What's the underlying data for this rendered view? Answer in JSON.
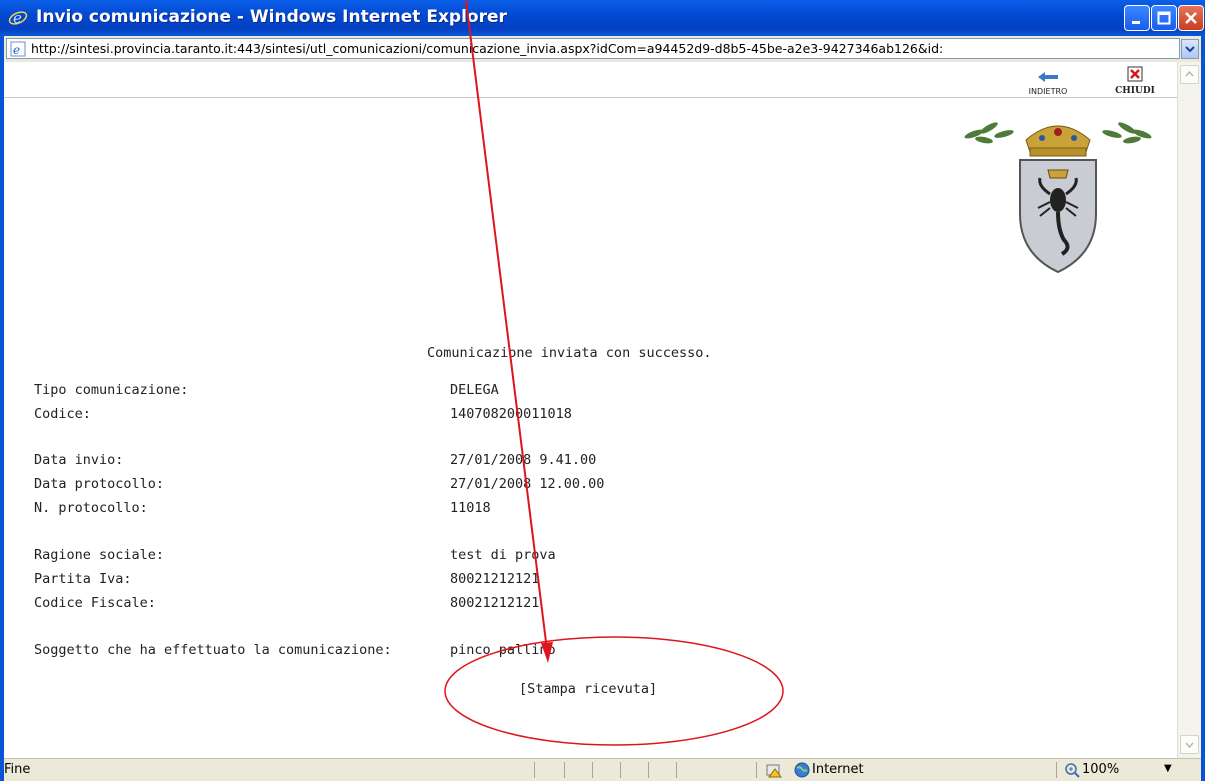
{
  "window": {
    "title": "Invio comunicazione - Windows Internet Explorer"
  },
  "address": {
    "url": "http://sintesi.provincia.taranto.it:443/sintesi/utl_comunicazioni/comunicazione_invia.aspx?idCom=a94452d9-d8b5-45be-a2e3-9427346ab126&id:"
  },
  "nav": {
    "back_label": "INDIETRO",
    "close_label": "CHIUDI"
  },
  "message": {
    "success": "Comunicazione inviata con successo."
  },
  "details": {
    "tipo_label": "Tipo comunicazione:",
    "tipo_value": "DELEGA",
    "codice_label": "Codice:",
    "codice_value": "140708200011018",
    "data_invio_label": "Data invio:",
    "data_invio_value": "27/01/2008 9.41.00",
    "data_prot_label": "Data protocollo:",
    "data_prot_value": "27/01/2008 12.00.00",
    "n_prot_label": "N. protocollo:",
    "n_prot_value": "11018",
    "ragione_label": "Ragione sociale:",
    "ragione_value": "test di prova",
    "piva_label": "Partita Iva:",
    "piva_value": "80021212121",
    "cf_label": "Codice Fiscale:",
    "cf_value": "80021212121",
    "soggetto_label": "Soggetto che ha effettuato la comunicazione:",
    "soggetto_value": "pinco pallino"
  },
  "actions": {
    "print_receipt": "[Stampa ricevuta]"
  },
  "status": {
    "text": "Fine",
    "zone": "Internet",
    "zoom": "100%"
  },
  "colors": {
    "annotation": "#e0141e",
    "titlebar": "#0347d0"
  }
}
